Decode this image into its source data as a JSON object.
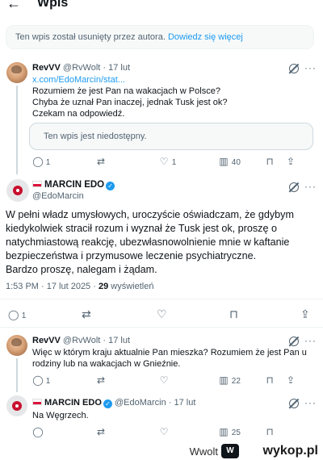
{
  "header": {
    "back_icon": "arrow-left-icon",
    "title": "Wpis"
  },
  "notice": {
    "text": "Ten wpis został usunięty przez autora.",
    "link": "Dowiedz się więcej"
  },
  "reply1": {
    "name": "RevVV",
    "handle": "@RvWolt · 17 lut",
    "link": "x.com/EdoMarcin/stat...",
    "lines": [
      "Rozumiem że jest Pan na wakacjach w Polsce?",
      "Chyba że uznał Pan inaczej, jednak Tusk jest ok?",
      "Czekam na odpowiedź."
    ],
    "quote": "Ten wpis jest niedostępny.",
    "actions": {
      "replies": "1",
      "retweets": "",
      "likes": "1",
      "views": "40"
    }
  },
  "main": {
    "name": "MARCIN EDO",
    "handle": "@EdoMarcin",
    "lines": [
      "W pełni władz umysłowych, uroczyście oświadczam, że gdybym",
      "kiedykolwiek stracił rozum i wyznał że Tusk jest ok, proszę o",
      "natychmiastową reakcję, ubezwłasnowolnienie mnie w kaftanie",
      "bezpieczeństwa i przymusowe leczenie psychiatryczne.",
      "Bardzo proszę, nalegam i żądam."
    ],
    "time": "1:53 PM · 17 lut 2025 ·",
    "views_count": "29",
    "views_label": "wyświetleń",
    "actions": {
      "replies": "1"
    }
  },
  "reply2": {
    "name": "RevVV",
    "handle": "@RvWolt · 17 lut",
    "lines": [
      "Więc w którym kraju aktualnie Pan mieszka? Rozumiem że jest Pan u",
      "rodziny lub na wakacjach w Gnieźnie."
    ],
    "actions": {
      "replies": "1",
      "views": "22"
    }
  },
  "reply3": {
    "name": "MARCIN EDO",
    "handle": "@EdoMarcin · 17 lut",
    "text": "Na Węgrzech.",
    "actions": {
      "replies": "",
      "views": "25"
    }
  },
  "footer": {
    "user": "Wwolt",
    "site": "wykop.pl",
    "logo": "wykop-logo"
  },
  "colors": {
    "accent": "#1d9bf0",
    "flag_red": "#dc143c",
    "muted": "#536471"
  }
}
